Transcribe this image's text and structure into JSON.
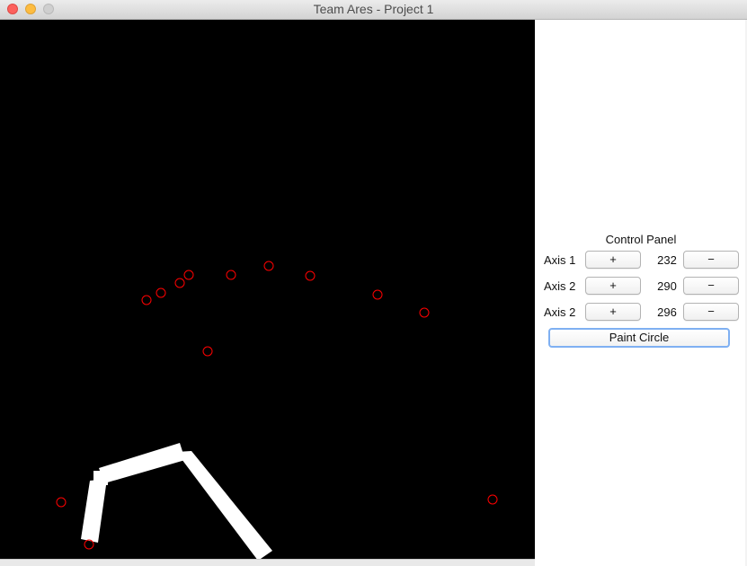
{
  "window": {
    "title": "Team Ares - Project 1"
  },
  "canvas": {
    "background": "#000000",
    "circle_color": "#ff0000",
    "arm_color": "#ffffff"
  },
  "control_panel": {
    "title": "Control Panel",
    "axes": [
      {
        "label": "Axis 1",
        "plus": "+",
        "value": "232",
        "minus": "−"
      },
      {
        "label": "Axis 2",
        "plus": "+",
        "value": "290",
        "minus": "−"
      },
      {
        "label": "Axis 2",
        "plus": "+",
        "value": "296",
        "minus": "−"
      }
    ],
    "paint_button": "Paint Circle"
  }
}
